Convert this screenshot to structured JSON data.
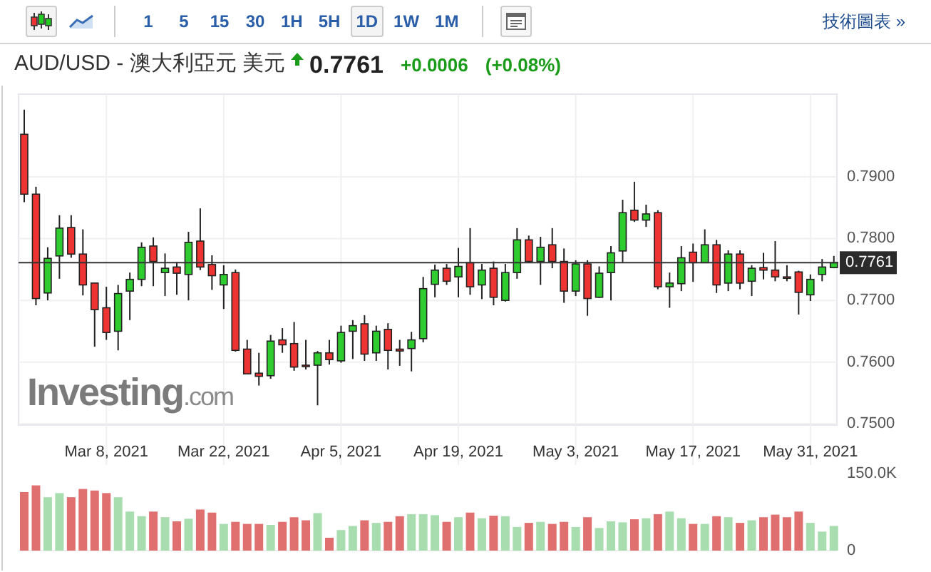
{
  "toolbar": {
    "chart_types": [
      {
        "kind": "candle",
        "selected": true
      },
      {
        "kind": "line",
        "selected": false
      }
    ],
    "intervals": [
      {
        "label": "1",
        "selected": false
      },
      {
        "label": "5",
        "selected": false
      },
      {
        "label": "15",
        "selected": false
      },
      {
        "label": "30",
        "selected": false
      },
      {
        "label": "1H",
        "selected": false
      },
      {
        "label": "5H",
        "selected": false
      },
      {
        "label": "1D",
        "selected": true
      },
      {
        "label": "1W",
        "selected": false
      },
      {
        "label": "1M",
        "selected": false
      }
    ],
    "link": "技術圖表 »"
  },
  "quote": {
    "title": "AUD/USD - 澳大利亞元 美元",
    "rising": true,
    "price": "0.7761",
    "change": "+0.0006",
    "change_percent": "(+0.08%)"
  },
  "logo": {
    "name": "Investing",
    "suffix": ".com"
  },
  "price_chart": {
    "chart_data": {
      "type": "candlestick",
      "grid": true,
      "ylim": [
        0.7498,
        0.8034
      ],
      "yticks": [
        {
          "value": 0.75,
          "label": "0.7500"
        },
        {
          "value": 0.76,
          "label": "0.7600"
        },
        {
          "value": 0.77,
          "label": "0.7700"
        },
        {
          "value": 0.78,
          "label": "0.7800"
        },
        {
          "value": 0.79,
          "label": "0.7900"
        }
      ],
      "categories": [
        null,
        null,
        null,
        null,
        null,
        null,
        null,
        "Mar 8, 2021",
        null,
        null,
        null,
        null,
        null,
        null,
        null,
        null,
        null,
        "Mar 22, 2021",
        null,
        null,
        null,
        null,
        null,
        null,
        null,
        null,
        null,
        "Apr 5, 2021",
        null,
        null,
        null,
        null,
        null,
        null,
        null,
        null,
        null,
        "Apr 19, 2021",
        null,
        null,
        null,
        null,
        null,
        null,
        null,
        null,
        null,
        "May 3, 2021",
        null,
        null,
        null,
        null,
        null,
        null,
        null,
        null,
        null,
        "May 17, 2021",
        null,
        null,
        null,
        null,
        null,
        null,
        null,
        null,
        null,
        "May 31, 2021",
        null,
        null
      ],
      "ohlc": [
        [
          0.7969,
          0.8009,
          0.7859,
          0.7872
        ],
        [
          0.7872,
          0.7884,
          0.7692,
          0.7703
        ],
        [
          0.7712,
          0.7786,
          0.77,
          0.7768
        ],
        [
          0.7772,
          0.7838,
          0.7735,
          0.7817
        ],
        [
          0.7818,
          0.7838,
          0.7769,
          0.7775
        ],
        [
          0.7775,
          0.7815,
          0.7708,
          0.7725
        ],
        [
          0.7728,
          0.7728,
          0.7625,
          0.7685
        ],
        [
          0.7688,
          0.7722,
          0.7636,
          0.7648
        ],
        [
          0.765,
          0.7725,
          0.7619,
          0.7711
        ],
        [
          0.7715,
          0.7745,
          0.7668,
          0.7734
        ],
        [
          0.7734,
          0.7794,
          0.7723,
          0.7786
        ],
        [
          0.7788,
          0.7802,
          0.7723,
          0.7763
        ],
        [
          0.7745,
          0.7776,
          0.7707,
          0.7752
        ],
        [
          0.7754,
          0.7762,
          0.7709,
          0.7744
        ],
        [
          0.7742,
          0.7811,
          0.77,
          0.7794
        ],
        [
          0.7796,
          0.7849,
          0.7749,
          0.7754
        ],
        [
          0.7758,
          0.7773,
          0.7717,
          0.774
        ],
        [
          0.7725,
          0.7757,
          0.7686,
          0.7742
        ],
        [
          0.7745,
          0.775,
          0.7617,
          0.7619
        ],
        [
          0.7621,
          0.7636,
          0.7581,
          0.7581
        ],
        [
          0.7582,
          0.7615,
          0.7562,
          0.7577
        ],
        [
          0.7578,
          0.7644,
          0.7573,
          0.7634
        ],
        [
          0.7636,
          0.7655,
          0.7615,
          0.7628
        ],
        [
          0.763,
          0.7665,
          0.7586,
          0.7592
        ],
        [
          0.7595,
          0.7636,
          0.7588,
          0.7594
        ],
        [
          0.7595,
          0.7618,
          0.753,
          0.7615
        ],
        [
          0.7615,
          0.7636,
          0.7596,
          0.7604
        ],
        [
          0.7602,
          0.7659,
          0.7599,
          0.7648
        ],
        [
          0.765,
          0.7668,
          0.7605,
          0.7659
        ],
        [
          0.7662,
          0.7676,
          0.7602,
          0.7613
        ],
        [
          0.7615,
          0.7659,
          0.7602,
          0.765
        ],
        [
          0.7653,
          0.7663,
          0.7588,
          0.7619
        ],
        [
          0.7621,
          0.7636,
          0.7594,
          0.7618
        ],
        [
          0.7622,
          0.7649,
          0.7585,
          0.7636
        ],
        [
          0.7638,
          0.7738,
          0.7632,
          0.7719
        ],
        [
          0.7726,
          0.7758,
          0.7705,
          0.7749
        ],
        [
          0.7752,
          0.7759,
          0.7725,
          0.7731
        ],
        [
          0.7738,
          0.7785,
          0.7705,
          0.7755
        ],
        [
          0.7761,
          0.7817,
          0.7709,
          0.7722
        ],
        [
          0.7725,
          0.7759,
          0.7702,
          0.7749
        ],
        [
          0.7752,
          0.7763,
          0.7692,
          0.7705
        ],
        [
          0.77,
          0.7759,
          0.7698,
          0.7745
        ],
        [
          0.7745,
          0.7817,
          0.7735,
          0.7798
        ],
        [
          0.7798,
          0.7805,
          0.7761,
          0.7763
        ],
        [
          0.7763,
          0.7803,
          0.7725,
          0.7786
        ],
        [
          0.779,
          0.7817,
          0.7752,
          0.7763
        ],
        [
          0.7763,
          0.7784,
          0.7696,
          0.7715
        ],
        [
          0.7715,
          0.7765,
          0.7707,
          0.7759
        ],
        [
          0.7759,
          0.7765,
          0.7675,
          0.7703
        ],
        [
          0.7705,
          0.7755,
          0.7704,
          0.7744
        ],
        [
          0.7745,
          0.7788,
          0.77,
          0.7777
        ],
        [
          0.778,
          0.7863,
          0.7761,
          0.7842
        ],
        [
          0.7846,
          0.7892,
          0.7827,
          0.783
        ],
        [
          0.783,
          0.7855,
          0.7819,
          0.784
        ],
        [
          0.7842,
          0.7846,
          0.7718,
          0.7722
        ],
        [
          0.7722,
          0.7745,
          0.7688,
          0.7728
        ],
        [
          0.7727,
          0.7788,
          0.7715,
          0.7769
        ],
        [
          0.7778,
          0.7792,
          0.773,
          0.7761
        ],
        [
          0.7761,
          0.7815,
          0.7761,
          0.779
        ],
        [
          0.779,
          0.7798,
          0.7712,
          0.7725
        ],
        [
          0.7728,
          0.7781,
          0.7715,
          0.7775
        ],
        [
          0.7775,
          0.7781,
          0.7718,
          0.7728
        ],
        [
          0.7731,
          0.7757,
          0.7707,
          0.7752
        ],
        [
          0.7753,
          0.7777,
          0.7734,
          0.7749
        ],
        [
          0.7749,
          0.7796,
          0.7731,
          0.7738
        ],
        [
          0.7738,
          0.7757,
          0.7731,
          0.7737
        ],
        [
          0.7746,
          0.7748,
          0.7677,
          0.7713
        ],
        [
          0.7709,
          0.7742,
          0.7699,
          0.7734
        ],
        [
          0.7742,
          0.7767,
          0.7731,
          0.7754
        ],
        [
          0.7753,
          0.7772,
          0.7752,
          0.7761
        ]
      ],
      "ref_lines": [
        {
          "axis": "y",
          "value": 0.7761,
          "label": "0.7761"
        }
      ]
    }
  },
  "volume_chart": {
    "chart_data": {
      "type": "bar",
      "ylim": [
        0,
        150
      ],
      "yticks": [
        {
          "value": 0,
          "label": "0"
        },
        {
          "value": 150,
          "label": "150.0K"
        }
      ],
      "values": [
        114,
        127,
        104,
        112,
        104,
        120,
        117,
        112,
        104,
        76,
        67,
        76,
        65,
        57,
        62,
        80,
        74,
        52,
        56,
        52,
        52,
        50,
        56,
        65,
        59,
        73,
        25,
        40,
        48,
        59,
        54,
        56,
        67,
        71,
        71,
        69,
        56,
        65,
        74,
        63,
        68,
        67,
        46,
        54,
        56,
        52,
        56,
        46,
        65,
        44,
        57,
        55,
        61,
        63,
        71,
        76,
        63,
        52,
        52,
        67,
        65,
        54,
        59,
        65,
        70,
        65,
        76,
        54,
        37,
        48
      ]
    }
  }
}
